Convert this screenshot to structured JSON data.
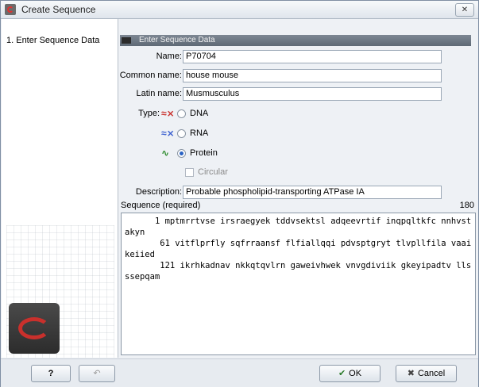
{
  "window": {
    "title": "Create Sequence",
    "close_glyph": "✕"
  },
  "nav": {
    "items": [
      {
        "label": "1. Enter Sequence Data"
      }
    ]
  },
  "section": {
    "title": "Enter Sequence Data"
  },
  "form": {
    "name_label": "Name:",
    "name_value": "P70704",
    "common_name_label": "Common name:",
    "common_name_value": "house mouse",
    "latin_name_label": "Latin name:",
    "latin_name_value": "Musmusculus",
    "type_label": "Type:",
    "types": [
      {
        "label": "DNA",
        "selected": false,
        "icon": "dna-icon"
      },
      {
        "label": "RNA",
        "selected": false,
        "icon": "rna-icon"
      },
      {
        "label": "Protein",
        "selected": true,
        "icon": "protein-icon"
      }
    ],
    "circular_label": "Circular",
    "description_label": "Description:",
    "description_value": "Probable phospholipid-transporting ATPase IA",
    "sequence_label": "Sequence (required)",
    "sequence_count": "180",
    "sequence_value": "      1 mptmrrtvse irsraegyek tddvsektsl adqeevrtif inqpqltkfc nnhvstakyn\n       61 vitflprfly sqfrraansf flfiallqqi pdvsptgryt tlvpllfila vaaikeiied\n       121 ikrhkadnav nkkqtqvlrn gaweivhwek vnvgdiviik gkeyipadtv llsssepqam"
  },
  "footer": {
    "help_label": "?",
    "back_glyph": "↶",
    "ok_label": "OK",
    "cancel_label": "Cancel"
  }
}
